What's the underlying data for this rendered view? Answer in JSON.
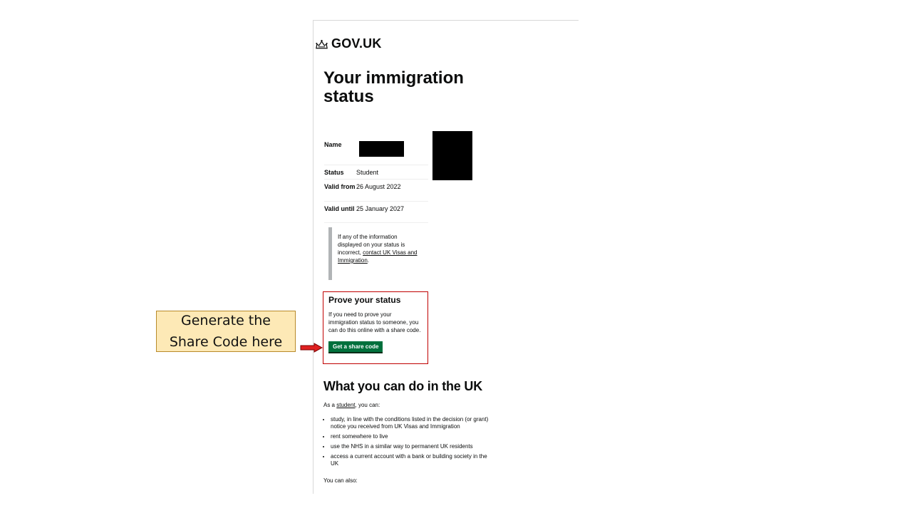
{
  "header": {
    "logo_text": "GOV.UK",
    "logo_icon": "crown-icon"
  },
  "title": "Your immigration status",
  "summary": [
    {
      "key": "Name",
      "value": ""
    },
    {
      "key": "Status",
      "value": "Student"
    },
    {
      "key": "Valid from",
      "value": "26 August 2022"
    },
    {
      "key": "Valid until",
      "value": "25 January 2027"
    }
  ],
  "inset": {
    "text": "If any of the information displayed on your status is incorrect,",
    "link": "contact UK Visas and Immigration",
    "suffix": "."
  },
  "prove": {
    "title": "Prove your status",
    "text": "If you need to prove your immigration status to someone, you can do this online with a share code.",
    "button": "Get a share code"
  },
  "uk_section": {
    "title": "What you can do in the UK",
    "intro_prefix": "As a",
    "intro_link": "student",
    "intro_suffix": ", you can:",
    "bullets": [
      "study, in line with the conditions listed in the decision (or grant) notice you received from UK Visas and Immigration",
      "rent somewhere to live",
      "use the NHS in a similar way to permanent UK residents",
      "access a current account with a bank or building society in the UK"
    ],
    "also": "You can also:"
  },
  "callout": {
    "line1": "Generate the",
    "line2": "Share Code here"
  },
  "colors": {
    "button_green": "#00703c",
    "highlight_red": "#c00000",
    "callout_fill": "#fde9b6"
  }
}
